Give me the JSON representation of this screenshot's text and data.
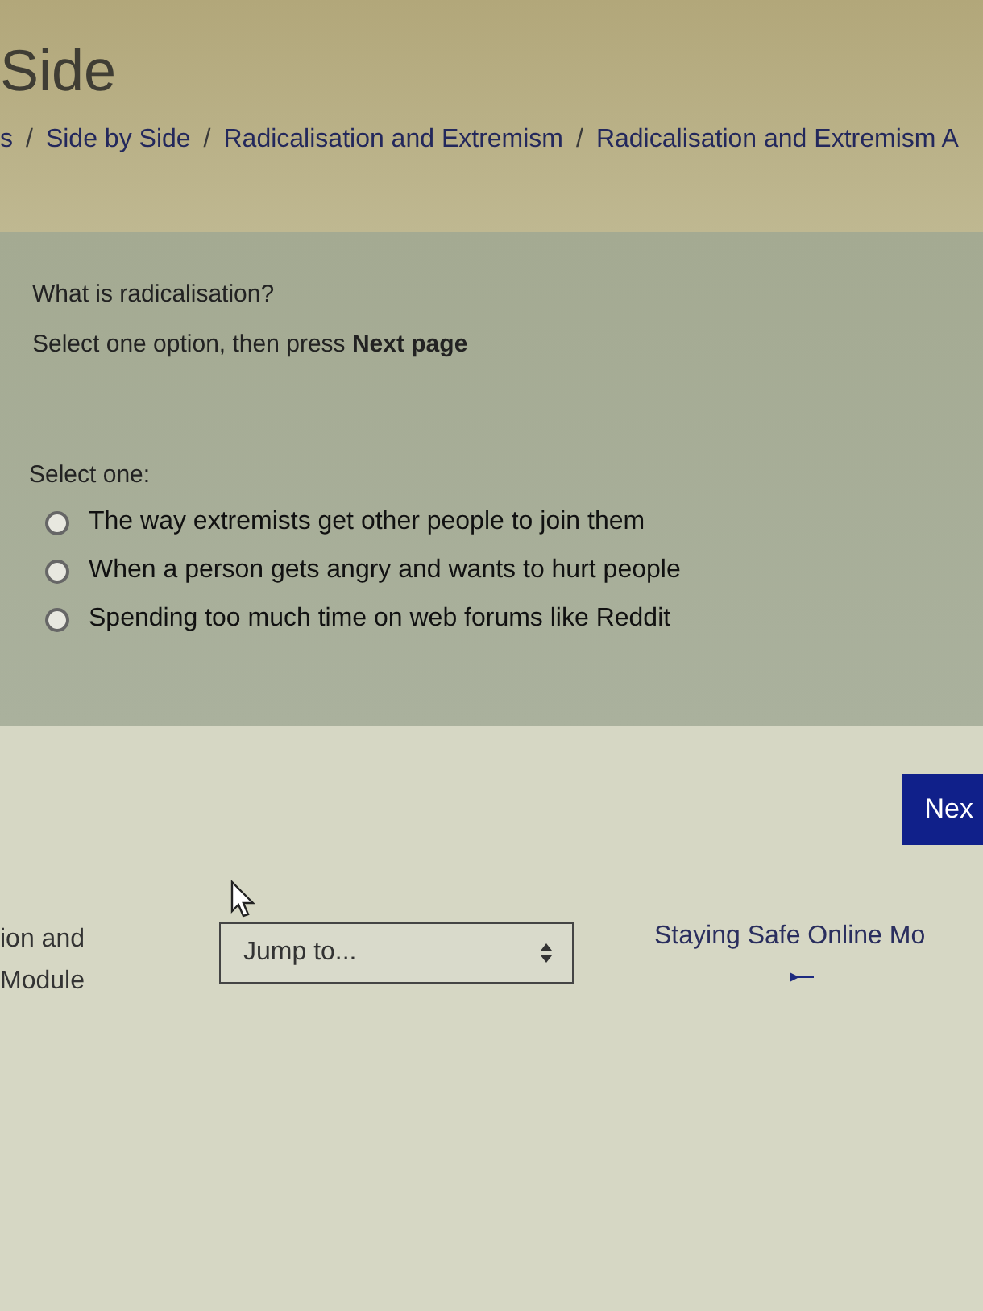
{
  "page_title": "Side",
  "breadcrumb_separator": "/",
  "breadcrumb": [
    "s",
    "Side by Side",
    "Radicalisation and Extremism",
    "Radicalisation and Extremism A"
  ],
  "question": {
    "text": "What is radicalisation?",
    "instruction": "Select one option, then press **Next page**",
    "prompt": "Select one:",
    "options": [
      {
        "label": "The way extremists get other people to join them",
        "selected": false
      },
      {
        "label": "When a person gets angry and wants to hurt people",
        "selected": false
      },
      {
        "label": "Spending too much time on web forums like Reddit",
        "selected": false
      }
    ]
  },
  "next_button": "Nex",
  "previous_link": [
    "ion and",
    "Module"
  ],
  "jump_select": {
    "placeholder": "Jump to..."
  },
  "next_link": "Staying Safe Online Mo"
}
